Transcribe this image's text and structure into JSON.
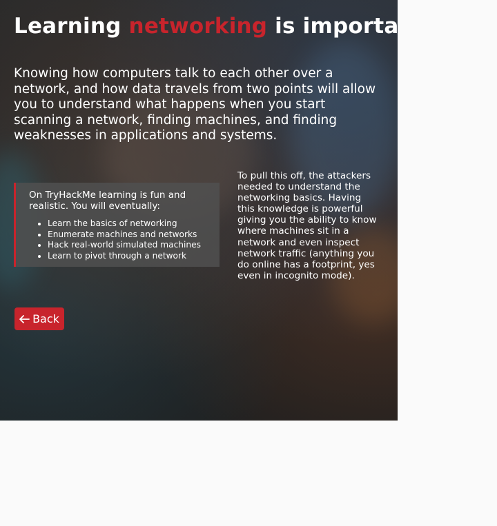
{
  "hero": {
    "title_prefix": "Learning ",
    "title_accent": "networking",
    "title_suffix": " is important",
    "intro": "Knowing how computers talk to each other over a network, and how data travels from two points will allow you to understand what happens when you start scanning a network, finding machines, and finding weaknesses in applications and systems."
  },
  "callout": {
    "intro": "On TryHackMe learning is fun and realistic. You will eventually:",
    "items": [
      "Learn the basics of networking",
      "Enumerate machines and networks",
      "Hack real-world simulated machines",
      "Learn to pivot through a network"
    ]
  },
  "side_text": "To pull this off, the attackers needed to understand the networking basics. Having this knowledge is powerful giving you the ability to know where machines sit in a network and even inspect network traffic (anything you do online has a footprint, yes even in incognito mode).",
  "back_button": {
    "label": "Back",
    "icon": "arrow-left-icon"
  },
  "colors": {
    "accent": "#c8242c",
    "panel_bg": "#232323",
    "page_bg": "#fafafa"
  }
}
